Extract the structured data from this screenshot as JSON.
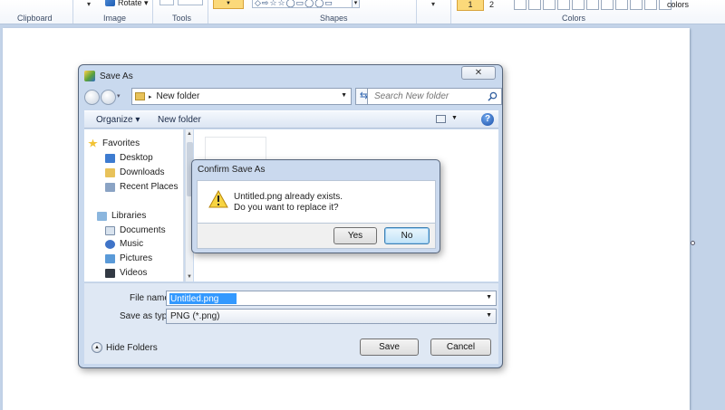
{
  "ribbon": {
    "groups": [
      "Clipboard",
      "Image",
      "Tools",
      "Shapes",
      "Colors"
    ],
    "rotate_label": "Rotate",
    "shapes_preview": "◇⇨☆☆◯▭◯◯▭",
    "color1_label": "1",
    "color2_label": "2",
    "edit_colors_label": "colors",
    "swatch_count": 11
  },
  "save_as": {
    "title": "Save As",
    "close_label": "✕",
    "address_path": "New folder",
    "search_placeholder": "Search New folder",
    "toolbar": {
      "organize": "Organize ▾",
      "new_folder": "New folder"
    },
    "nav": {
      "favorites": "Favorites",
      "desktop": "Desktop",
      "downloads": "Downloads",
      "recent_places": "Recent Places",
      "libraries": "Libraries",
      "documents": "Documents",
      "music": "Music",
      "pictures": "Pictures",
      "videos": "Videos"
    },
    "file_name_label": "File name:",
    "file_name_value": "Untitled.png",
    "save_as_type_label": "Save as type:",
    "save_as_type_value": "PNG (*.png)",
    "hide_folders": "Hide Folders",
    "save_button": "Save",
    "cancel_button": "Cancel"
  },
  "confirm": {
    "title": "Confirm Save As",
    "message_line1": "Untitled.png already exists.",
    "message_line2": "Do you want to replace it?",
    "yes_button": "Yes",
    "no_button": "No"
  },
  "colors": {
    "selection_highlight": "#3399ff",
    "ribbon_active": "#fbd97a",
    "workspace": "#c3d3e8"
  }
}
